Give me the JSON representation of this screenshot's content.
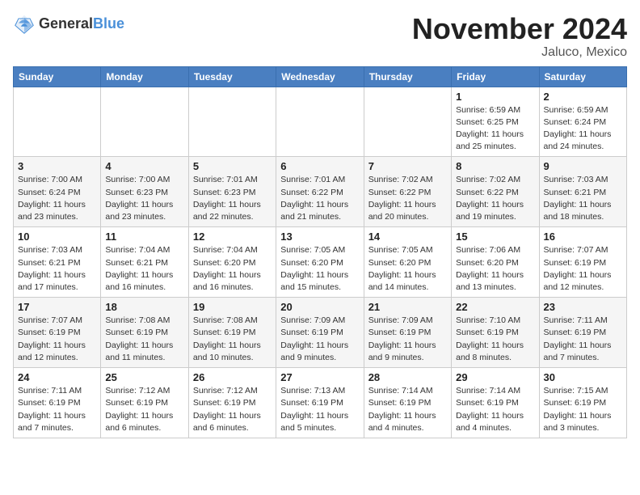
{
  "logo": {
    "general": "General",
    "blue": "Blue"
  },
  "header": {
    "month": "November 2024",
    "location": "Jaluco, Mexico"
  },
  "weekdays": [
    "Sunday",
    "Monday",
    "Tuesday",
    "Wednesday",
    "Thursday",
    "Friday",
    "Saturday"
  ],
  "weeks": [
    [
      {
        "day": "",
        "info": ""
      },
      {
        "day": "",
        "info": ""
      },
      {
        "day": "",
        "info": ""
      },
      {
        "day": "",
        "info": ""
      },
      {
        "day": "",
        "info": ""
      },
      {
        "day": "1",
        "info": "Sunrise: 6:59 AM\nSunset: 6:25 PM\nDaylight: 11 hours and 25 minutes."
      },
      {
        "day": "2",
        "info": "Sunrise: 6:59 AM\nSunset: 6:24 PM\nDaylight: 11 hours and 24 minutes."
      }
    ],
    [
      {
        "day": "3",
        "info": "Sunrise: 7:00 AM\nSunset: 6:24 PM\nDaylight: 11 hours and 23 minutes."
      },
      {
        "day": "4",
        "info": "Sunrise: 7:00 AM\nSunset: 6:23 PM\nDaylight: 11 hours and 23 minutes."
      },
      {
        "day": "5",
        "info": "Sunrise: 7:01 AM\nSunset: 6:23 PM\nDaylight: 11 hours and 22 minutes."
      },
      {
        "day": "6",
        "info": "Sunrise: 7:01 AM\nSunset: 6:22 PM\nDaylight: 11 hours and 21 minutes."
      },
      {
        "day": "7",
        "info": "Sunrise: 7:02 AM\nSunset: 6:22 PM\nDaylight: 11 hours and 20 minutes."
      },
      {
        "day": "8",
        "info": "Sunrise: 7:02 AM\nSunset: 6:22 PM\nDaylight: 11 hours and 19 minutes."
      },
      {
        "day": "9",
        "info": "Sunrise: 7:03 AM\nSunset: 6:21 PM\nDaylight: 11 hours and 18 minutes."
      }
    ],
    [
      {
        "day": "10",
        "info": "Sunrise: 7:03 AM\nSunset: 6:21 PM\nDaylight: 11 hours and 17 minutes."
      },
      {
        "day": "11",
        "info": "Sunrise: 7:04 AM\nSunset: 6:21 PM\nDaylight: 11 hours and 16 minutes."
      },
      {
        "day": "12",
        "info": "Sunrise: 7:04 AM\nSunset: 6:20 PM\nDaylight: 11 hours and 16 minutes."
      },
      {
        "day": "13",
        "info": "Sunrise: 7:05 AM\nSunset: 6:20 PM\nDaylight: 11 hours and 15 minutes."
      },
      {
        "day": "14",
        "info": "Sunrise: 7:05 AM\nSunset: 6:20 PM\nDaylight: 11 hours and 14 minutes."
      },
      {
        "day": "15",
        "info": "Sunrise: 7:06 AM\nSunset: 6:20 PM\nDaylight: 11 hours and 13 minutes."
      },
      {
        "day": "16",
        "info": "Sunrise: 7:07 AM\nSunset: 6:19 PM\nDaylight: 11 hours and 12 minutes."
      }
    ],
    [
      {
        "day": "17",
        "info": "Sunrise: 7:07 AM\nSunset: 6:19 PM\nDaylight: 11 hours and 12 minutes."
      },
      {
        "day": "18",
        "info": "Sunrise: 7:08 AM\nSunset: 6:19 PM\nDaylight: 11 hours and 11 minutes."
      },
      {
        "day": "19",
        "info": "Sunrise: 7:08 AM\nSunset: 6:19 PM\nDaylight: 11 hours and 10 minutes."
      },
      {
        "day": "20",
        "info": "Sunrise: 7:09 AM\nSunset: 6:19 PM\nDaylight: 11 hours and 9 minutes."
      },
      {
        "day": "21",
        "info": "Sunrise: 7:09 AM\nSunset: 6:19 PM\nDaylight: 11 hours and 9 minutes."
      },
      {
        "day": "22",
        "info": "Sunrise: 7:10 AM\nSunset: 6:19 PM\nDaylight: 11 hours and 8 minutes."
      },
      {
        "day": "23",
        "info": "Sunrise: 7:11 AM\nSunset: 6:19 PM\nDaylight: 11 hours and 7 minutes."
      }
    ],
    [
      {
        "day": "24",
        "info": "Sunrise: 7:11 AM\nSunset: 6:19 PM\nDaylight: 11 hours and 7 minutes."
      },
      {
        "day": "25",
        "info": "Sunrise: 7:12 AM\nSunset: 6:19 PM\nDaylight: 11 hours and 6 minutes."
      },
      {
        "day": "26",
        "info": "Sunrise: 7:12 AM\nSunset: 6:19 PM\nDaylight: 11 hours and 6 minutes."
      },
      {
        "day": "27",
        "info": "Sunrise: 7:13 AM\nSunset: 6:19 PM\nDaylight: 11 hours and 5 minutes."
      },
      {
        "day": "28",
        "info": "Sunrise: 7:14 AM\nSunset: 6:19 PM\nDaylight: 11 hours and 4 minutes."
      },
      {
        "day": "29",
        "info": "Sunrise: 7:14 AM\nSunset: 6:19 PM\nDaylight: 11 hours and 4 minutes."
      },
      {
        "day": "30",
        "info": "Sunrise: 7:15 AM\nSunset: 6:19 PM\nDaylight: 11 hours and 3 minutes."
      }
    ]
  ]
}
